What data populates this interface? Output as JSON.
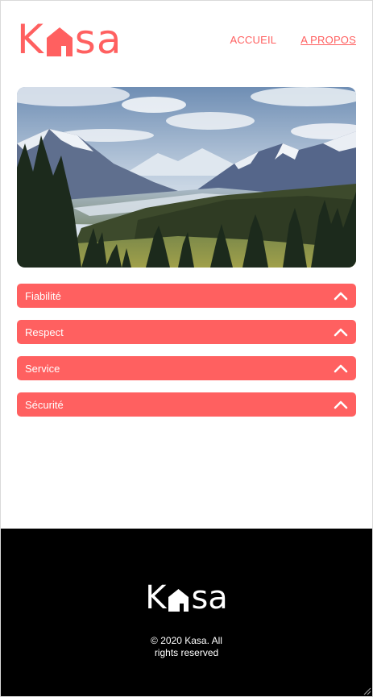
{
  "header": {
    "logo_text_left": "K",
    "logo_text_right": "sa",
    "nav": [
      {
        "label": "ACCUEIL"
      },
      {
        "label": "A PROPOS"
      }
    ]
  },
  "banner": {
    "alt": "Mountain landscape"
  },
  "collapses": [
    {
      "title": "Fiabilité"
    },
    {
      "title": "Respect"
    },
    {
      "title": "Service"
    },
    {
      "title": "Sécurité"
    }
  ],
  "footer": {
    "logo_text_left": "K",
    "logo_text_right": "sa",
    "copyright": "© 2020 Kasa. All rights reserved"
  },
  "colors": {
    "brand": "#FF6060",
    "footer_bg": "#000000"
  },
  "icons": [
    "house-icon",
    "chevron-up-icon"
  ]
}
